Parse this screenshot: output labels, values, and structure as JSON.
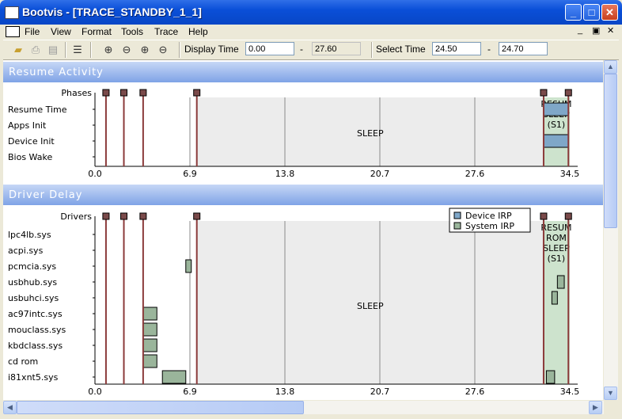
{
  "window": {
    "title": "Bootvis - [TRACE_STANDBY_1_1]"
  },
  "menu": [
    {
      "label": "File",
      "accel": "F"
    },
    {
      "label": "View",
      "accel": "V"
    },
    {
      "label": "Format",
      "accel": "o"
    },
    {
      "label": "Tools",
      "accel": "l"
    },
    {
      "label": "Trace",
      "accel": "T"
    },
    {
      "label": "Help",
      "accel": "H"
    }
  ],
  "toolbar": {
    "display_time_label": "Display Time",
    "display_time_from": "0.00",
    "display_time_sep": "-",
    "display_time_to": "27.60",
    "select_time_label": "Select Time",
    "select_time_from": "24.50",
    "select_time_sep": "-",
    "select_time_to": "24.70"
  },
  "icons": {
    "open": "folder-open-icon",
    "print": "print-icon",
    "preview": "print-preview-icon",
    "list": "list-icon",
    "zoom_in": "zoom-in-icon",
    "zoom_out": "zoom-out-icon",
    "zoom_in2": "zoom-in-select-icon",
    "zoom_out2": "zoom-out-select-icon"
  },
  "colors": {
    "phase_marker": "#7a4a4a",
    "phase_line": "#8b3a3a",
    "sleep_bg": "#ececec",
    "device_irp": "#7fa7c8",
    "system_irp": "#9ab59b",
    "resume_bg": "#cde3cd",
    "header_top": "#c6d7f6",
    "header_bottom": "#7fa3e6"
  },
  "chart_data": [
    {
      "type": "timeline",
      "title": "Resume Activity",
      "marker_row_label": "Phases",
      "rows": [
        "Resume Time",
        "Apps Init",
        "Device Init",
        "Bios Wake"
      ],
      "x_ticks": [
        "0.0",
        "6.9",
        "13.8",
        "20.7",
        "27.6",
        "34.5"
      ],
      "xlim": [
        0,
        34.5
      ],
      "grid": true,
      "phase_markers": [
        0.8,
        2.1,
        3.5,
        7.4,
        32.6,
        34.4
      ],
      "region_label": "SLEEP",
      "sleep_region": [
        7.4,
        32.6
      ],
      "resume_labels": [
        "RESUM",
        "SLEEP",
        "(S1)"
      ],
      "bars": [
        {
          "row": "Resume Time",
          "start": 32.6,
          "end": 34.4,
          "type": "Device IRP"
        },
        {
          "row": "Device Init",
          "start": 32.6,
          "end": 34.4,
          "type": "Device IRP"
        }
      ]
    },
    {
      "type": "timeline",
      "title": "Driver Delay",
      "marker_row_label": "Drivers",
      "rows": [
        "lpc4lb.sys",
        "acpi.sys",
        "pcmcia.sys",
        "usbhub.sys",
        "usbuhci.sys",
        "ac97intc.sys",
        "mouclass.sys",
        "kbdclass.sys",
        "cd rom",
        "i81xnt5.sys"
      ],
      "x_ticks": [
        "0.0",
        "6.9",
        "13.8",
        "20.7",
        "27.6",
        "34.5"
      ],
      "xlim": [
        0,
        34.5
      ],
      "grid": true,
      "phase_markers": [
        0.8,
        2.1,
        3.5,
        7.4,
        32.6,
        34.4
      ],
      "region_label": "SLEEP",
      "sleep_region": [
        7.4,
        32.6
      ],
      "resume_labels": [
        "RESUM",
        "ROM",
        "SLEEP",
        "(S1)"
      ],
      "legend": {
        "entries": [
          "Device IRP",
          "System IRP"
        ],
        "placement": "top-right"
      },
      "bars": [
        {
          "row": "pcmcia.sys",
          "start": 6.6,
          "end": 7.0,
          "type": "System IRP"
        },
        {
          "row": "usbhub.sys",
          "start": 33.6,
          "end": 34.1,
          "type": "System IRP"
        },
        {
          "row": "usbuhci.sys",
          "start": 33.2,
          "end": 33.6,
          "type": "System IRP"
        },
        {
          "row": "ac97intc.sys",
          "start": 3.5,
          "end": 4.5,
          "type": "System IRP"
        },
        {
          "row": "mouclass.sys",
          "start": 3.5,
          "end": 4.5,
          "type": "System IRP"
        },
        {
          "row": "kbdclass.sys",
          "start": 3.5,
          "end": 4.5,
          "type": "System IRP"
        },
        {
          "row": "cd rom",
          "start": 3.5,
          "end": 4.5,
          "type": "System IRP"
        },
        {
          "row": "i81xnt5.sys",
          "start": 4.9,
          "end": 6.6,
          "type": "System IRP"
        },
        {
          "row": "i81xnt5.sys",
          "start": 32.8,
          "end": 33.4,
          "type": "System IRP"
        }
      ]
    }
  ]
}
